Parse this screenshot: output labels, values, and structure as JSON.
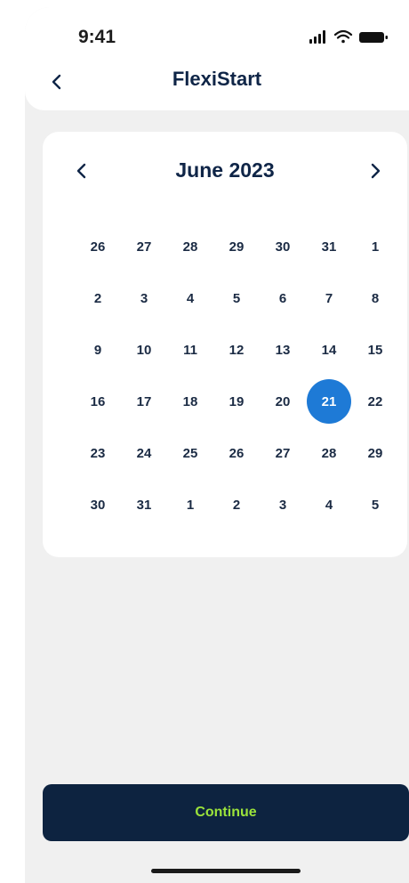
{
  "status_bar": {
    "time": "9:41"
  },
  "header": {
    "title": "FlexiStart",
    "back_icon": "chevron-left-icon"
  },
  "calendar": {
    "month_label": "June 2023",
    "prev_icon": "chevron-left-icon",
    "next_icon": "chevron-right-icon",
    "selected_date": "21",
    "weeks": [
      [
        "26",
        "27",
        "28",
        "29",
        "30",
        "31",
        "1"
      ],
      [
        "2",
        "3",
        "4",
        "5",
        "6",
        "7",
        "8"
      ],
      [
        "9",
        "10",
        "11",
        "12",
        "13",
        "14",
        "15"
      ],
      [
        "16",
        "17",
        "18",
        "19",
        "20",
        "21",
        "22"
      ],
      [
        "23",
        "24",
        "25",
        "26",
        "27",
        "28",
        "29"
      ],
      [
        "30",
        "31",
        "1",
        "2",
        "3",
        "4",
        "5"
      ]
    ]
  },
  "footer": {
    "continue_label": "Continue"
  },
  "colors": {
    "accent": "#1e7ad6",
    "primary_dark": "#0d2340",
    "cta_text": "#9be33b",
    "background": "#f0f0f0"
  }
}
